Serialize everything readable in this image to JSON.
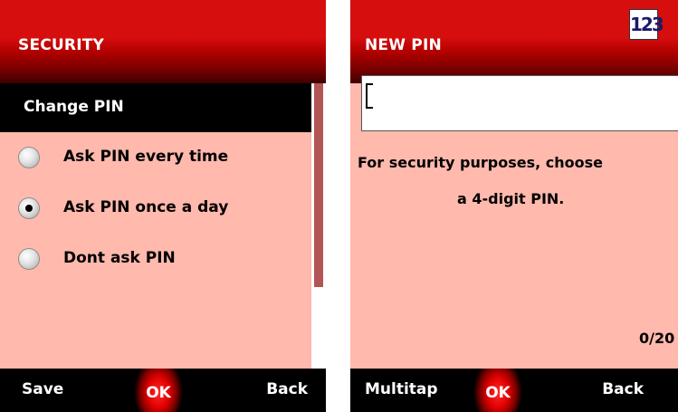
{
  "security_screen": {
    "title": "SECURITY",
    "menu_header": "Change PIN",
    "options": [
      {
        "label": "Ask PIN every time",
        "selected": false
      },
      {
        "label": "Ask PIN once a day",
        "selected": true
      },
      {
        "label": "Dont ask PIN",
        "selected": false
      }
    ],
    "softkeys": {
      "left": "Save",
      "center": "OK",
      "right": "Back"
    }
  },
  "new_pin_screen": {
    "title": "NEW PIN",
    "input_mode_icon": "123",
    "input_value": "",
    "message_line1": "For security purposes, choose",
    "message_line2": "a 4-digit PIN.",
    "char_count": "0/20",
    "softkeys": {
      "left": "Multitap",
      "center": "OK",
      "right": "Back"
    }
  },
  "colors": {
    "title_red": "#d60e0e",
    "body_pink": "#ffb9ad",
    "scrollbar_thumb": "#b35555"
  }
}
